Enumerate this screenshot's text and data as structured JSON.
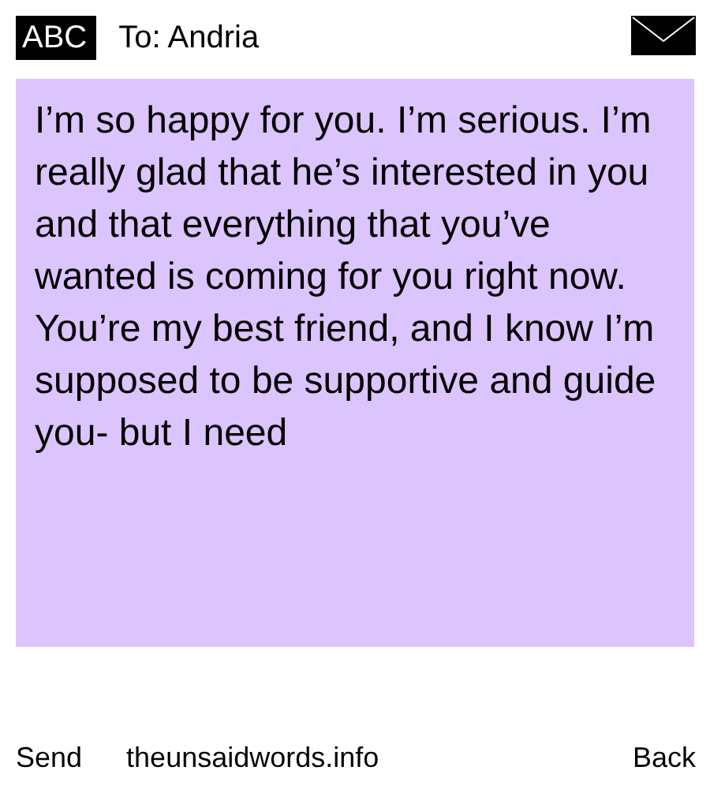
{
  "header": {
    "input_mode": "ABC",
    "recipient": "To: Andria"
  },
  "message": {
    "text": "I’m so happy for you. I’m serious. I’m really glad that he’s interested in you and that everything that you’ve wanted is coming for you right now. You’re my best friend, and I know I’m supposed to be supportive and guide you- but I need"
  },
  "footer": {
    "left": "Send",
    "center": "theunsaidwords.info",
    "right": "Back"
  }
}
